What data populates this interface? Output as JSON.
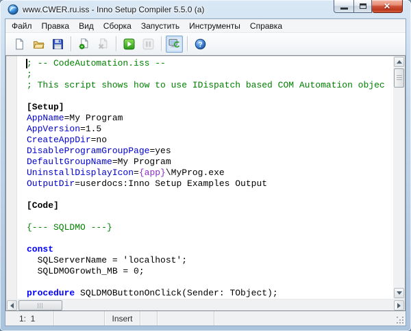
{
  "window": {
    "title": "www.CWER.ru.iss - Inno Setup Compiler 5.5.0 (a)",
    "app_icon": "inno-setup-icon",
    "control_icons": [
      "minimize-icon",
      "maximize-icon",
      "close-icon"
    ]
  },
  "menubar": {
    "items": [
      "Файл",
      "Правка",
      "Вид",
      "Сборка",
      "Запустить",
      "Инструменты",
      "Справка"
    ]
  },
  "toolbar": {
    "groups": [
      [
        {
          "name": "new-script",
          "icon": "new-document-icon"
        },
        {
          "name": "open-script",
          "icon": "open-folder-icon"
        },
        {
          "name": "save-script",
          "icon": "save-floppy-icon"
        }
      ],
      [
        {
          "name": "compile",
          "icon": "compile-icon"
        },
        {
          "name": "stop-compile",
          "icon": "stop-compile-icon",
          "disabled": true
        }
      ],
      [
        {
          "name": "run",
          "icon": "run-play-icon"
        },
        {
          "name": "pause",
          "icon": "pause-icon",
          "disabled": true
        }
      ],
      [
        {
          "name": "target-setup",
          "icon": "target-setup-icon",
          "pressed": true
        }
      ],
      [
        {
          "name": "help",
          "icon": "help-icon"
        }
      ]
    ]
  },
  "editor": {
    "lines": [
      [
        {
          "t": "; -- CodeAutomation.iss --",
          "s": "comment"
        }
      ],
      [
        {
          "t": ";",
          "s": "comment"
        }
      ],
      [
        {
          "t": "; This script shows how to use IDispatch based COM Automation objec",
          "s": "comment"
        }
      ],
      [],
      [
        {
          "t": "[Setup]",
          "s": "section"
        }
      ],
      [
        {
          "t": "AppName",
          "s": "directive"
        },
        {
          "t": "=My Program",
          "s": "plain"
        }
      ],
      [
        {
          "t": "AppVersion",
          "s": "directive"
        },
        {
          "t": "=1.5",
          "s": "plain"
        }
      ],
      [
        {
          "t": "CreateAppDir",
          "s": "directive"
        },
        {
          "t": "=no",
          "s": "plain"
        }
      ],
      [
        {
          "t": "DisableProgramGroupPage",
          "s": "directive"
        },
        {
          "t": "=yes",
          "s": "plain"
        }
      ],
      [
        {
          "t": "DefaultGroupName",
          "s": "directive"
        },
        {
          "t": "=My Program",
          "s": "plain"
        }
      ],
      [
        {
          "t": "UninstallDisplayIcon",
          "s": "directive"
        },
        {
          "t": "=",
          "s": "plain"
        },
        {
          "t": "{app}",
          "s": "constant"
        },
        {
          "t": "\\MyProg.exe",
          "s": "plain"
        }
      ],
      [
        {
          "t": "OutputDir",
          "s": "directive"
        },
        {
          "t": "=userdocs:Inno Setup Examples Output",
          "s": "plain"
        }
      ],
      [],
      [
        {
          "t": "[Code]",
          "s": "section"
        }
      ],
      [],
      [
        {
          "t": "{--- SQLDMO ---}",
          "s": "comment"
        }
      ],
      [],
      [
        {
          "t": "const",
          "s": "keyword"
        }
      ],
      [
        {
          "t": "  SQLServerName = 'localhost';",
          "s": "plain"
        }
      ],
      [
        {
          "t": "  SQLDMOGrowth_MB = 0;",
          "s": "plain"
        }
      ],
      [],
      [
        {
          "t": "procedure",
          "s": "keyword"
        },
        {
          "t": " SQLDMOButtonOnClick(Sender: TObject);",
          "s": "plain"
        }
      ]
    ]
  },
  "statusbar": {
    "panels": [
      "1:  1",
      "",
      "Insert",
      "",
      "",
      ""
    ]
  },
  "colors": {
    "comment": "#008000",
    "section": "#000000",
    "directive": "#0000cd",
    "keyword": "#0000ff",
    "constant": "#8a2bd0",
    "plain": "#000000",
    "close_button": "#cf4533",
    "run_green": "#3aa81f",
    "help_blue": "#2f6fc4"
  }
}
